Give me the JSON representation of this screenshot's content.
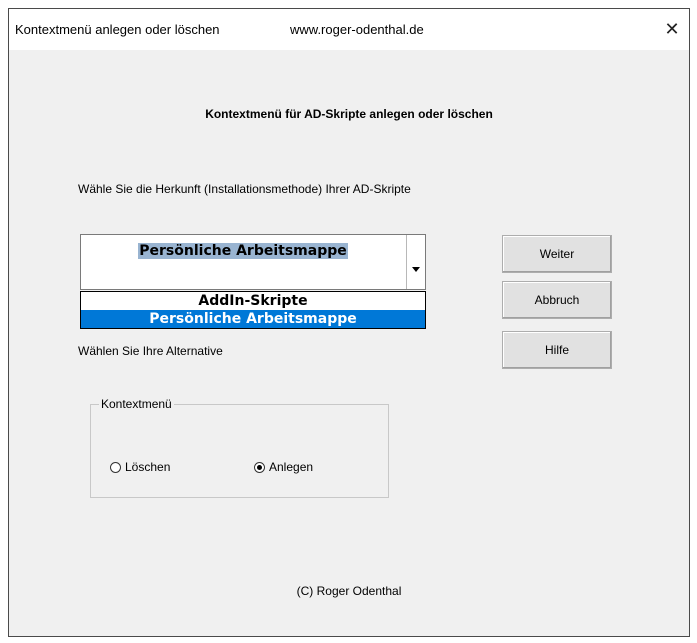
{
  "window": {
    "title": "Kontextmenü anlegen oder löschen",
    "url": "www.roger-odenthal.de",
    "close_symbol": "✕"
  },
  "dialog": {
    "heading": "Kontextmenü für AD-Skripte anlegen oder löschen",
    "prompt": "Wähle Sie die Herkunft (Installationsmethode) Ihrer AD-Skripte",
    "combo_value": "Persönliche Arbeitsmappe",
    "dropdown_options": [
      {
        "label": "AddIn-Skripte",
        "selected": false
      },
      {
        "label": "Persönliche Arbeitsmappe",
        "selected": true
      }
    ],
    "alternative_text": "Wählen Sie Ihre Alternative",
    "buttons": {
      "next": "Weiter",
      "cancel": "Abbruch",
      "help": "Hilfe"
    },
    "group": {
      "label": "Kontextmenü",
      "option_delete": "Löschen",
      "option_create": "Anlegen",
      "selected_option": "Anlegen"
    },
    "copyright": "(C) Roger Odenthal"
  },
  "icons": {
    "close": "close-icon",
    "dropdown_arrow": "chevron-down-icon"
  },
  "colors": {
    "dialog_background": "#f0f0f0",
    "selection_blue": "#0078d7",
    "combo_highlight": "#99b4d1"
  }
}
